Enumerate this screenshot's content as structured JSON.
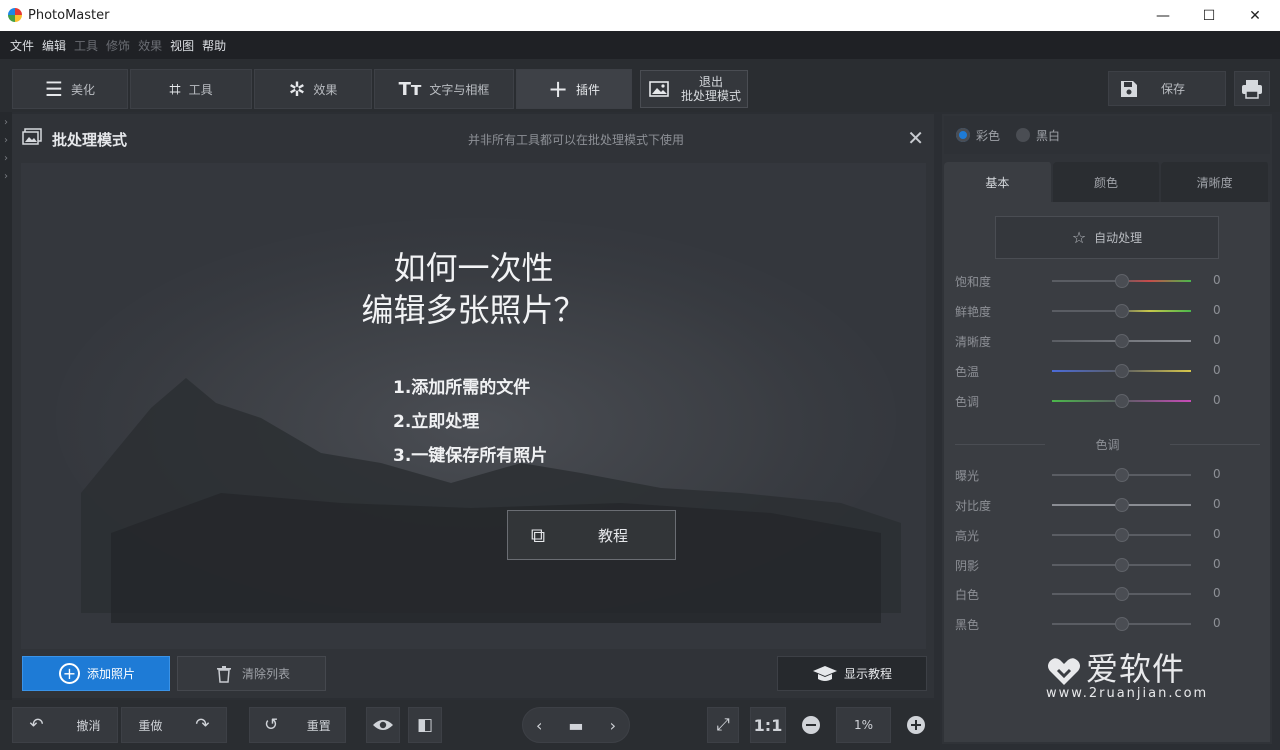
{
  "window": {
    "title": "PhotoMaster",
    "min": "—",
    "max": "☐",
    "close": "✕"
  },
  "menu": [
    {
      "label": "文件",
      "enabled": true
    },
    {
      "label": "编辑",
      "enabled": true
    },
    {
      "label": "工具",
      "enabled": false
    },
    {
      "label": "修饰",
      "enabled": false
    },
    {
      "label": "效果",
      "enabled": false
    },
    {
      "label": "视图",
      "enabled": true
    },
    {
      "label": "帮助",
      "enabled": true
    }
  ],
  "tabs": [
    {
      "label": "美化",
      "icon": "sliders-icon"
    },
    {
      "label": "工具",
      "icon": "crop-icon"
    },
    {
      "label": "效果",
      "icon": "magic-wand-icon"
    },
    {
      "label": "文字与相框",
      "icon": "text-icon"
    },
    {
      "label": "插件",
      "icon": "plus-icon"
    }
  ],
  "exit_batch": {
    "line1": "退出",
    "line2": "批处理模式"
  },
  "save": {
    "label": "保存"
  },
  "panel": {
    "title": "批处理模式",
    "notice": "并非所有工具都可以在批处理模式下使用",
    "headline_line1": "如何一次性",
    "headline_line2": "编辑多张照片？",
    "steps": [
      "1.添加所需的文件",
      "2.立即处理",
      "3.一键保存所有照片"
    ],
    "tutorial_button": "教程",
    "add_photos": "添加照片",
    "clear_list": "清除列表",
    "show_tutorial": "显示教程"
  },
  "bottom": {
    "undo": "撤消",
    "redo": "重做",
    "reset": "重置",
    "ratio": "1:1",
    "zoom": "1%"
  },
  "right": {
    "mode_color": "彩色",
    "mode_bw": "黑白",
    "tabs": [
      "基本",
      "颜色",
      "清晰度"
    ],
    "auto": "自动处理",
    "sliders": [
      {
        "label": "饱和度",
        "value": "0"
      },
      {
        "label": "鲜艳度",
        "value": "0"
      },
      {
        "label": "清晰度",
        "value": "0"
      },
      {
        "label": "色温",
        "value": "0"
      },
      {
        "label": "色调",
        "value": "0"
      }
    ],
    "tone_section": "色调",
    "tone_sliders": [
      {
        "label": "曝光",
        "value": "0"
      },
      {
        "label": "对比度",
        "value": "0"
      },
      {
        "label": "高光",
        "value": "0"
      },
      {
        "label": "阴影",
        "value": "0"
      },
      {
        "label": "白色",
        "value": "0"
      },
      {
        "label": "黑色",
        "value": "0"
      }
    ]
  },
  "watermark": {
    "brand": "爱软件",
    "url": "www.2ruanjian.com"
  },
  "colors": {
    "accent": "#1e7bd6",
    "bg": "#2b2e33",
    "panel": "#303338"
  }
}
